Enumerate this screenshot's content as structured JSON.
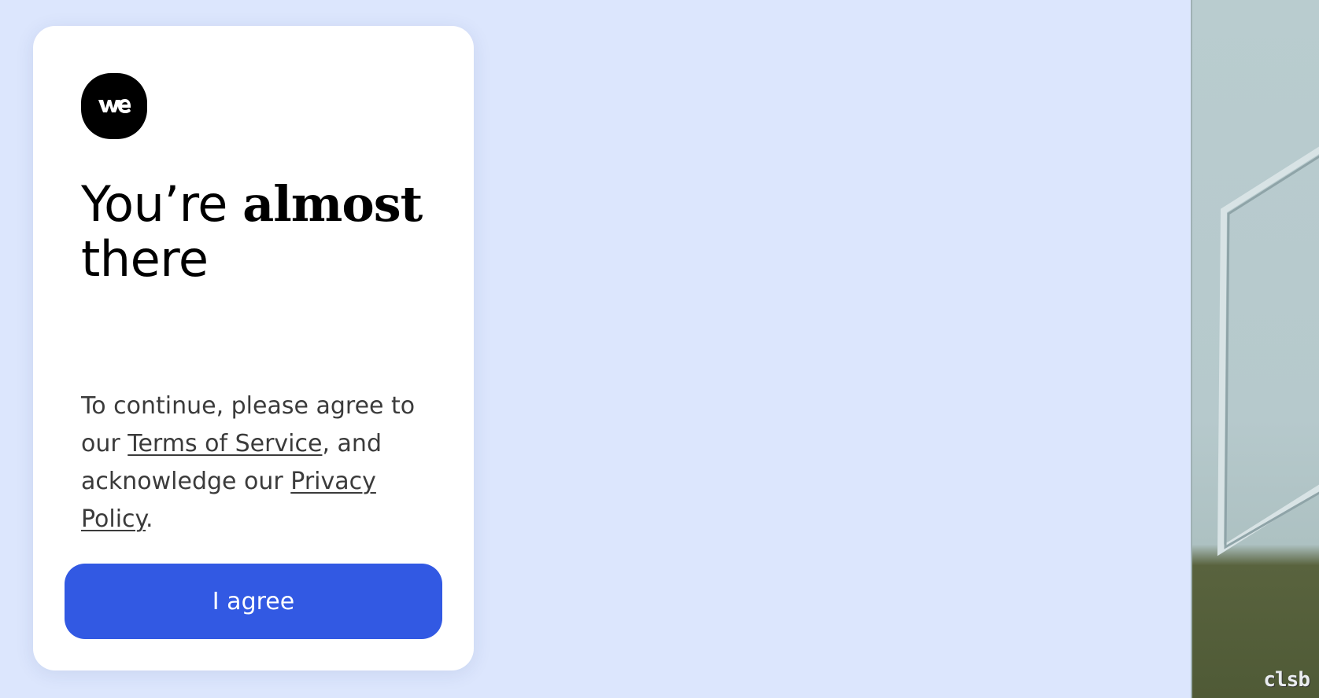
{
  "logo": {
    "icon": "wetransfer-logo-icon",
    "text": "we"
  },
  "headline": {
    "part1": "You’re ",
    "bold": "almost",
    "part2": "there"
  },
  "consent": {
    "text_before": "To continue, please agree to our ",
    "terms_link": "Terms of Service",
    "text_middle": ", and acknowledge our ",
    "privacy_link": "Privacy Policy",
    "text_after": "."
  },
  "agree_button": {
    "label": "I agree"
  },
  "side_image": {
    "watermark": "clsb"
  },
  "colors": {
    "background": "#dce6fd",
    "card": "#ffffff",
    "button": "#3259e3",
    "text": "#3b3b3b"
  }
}
